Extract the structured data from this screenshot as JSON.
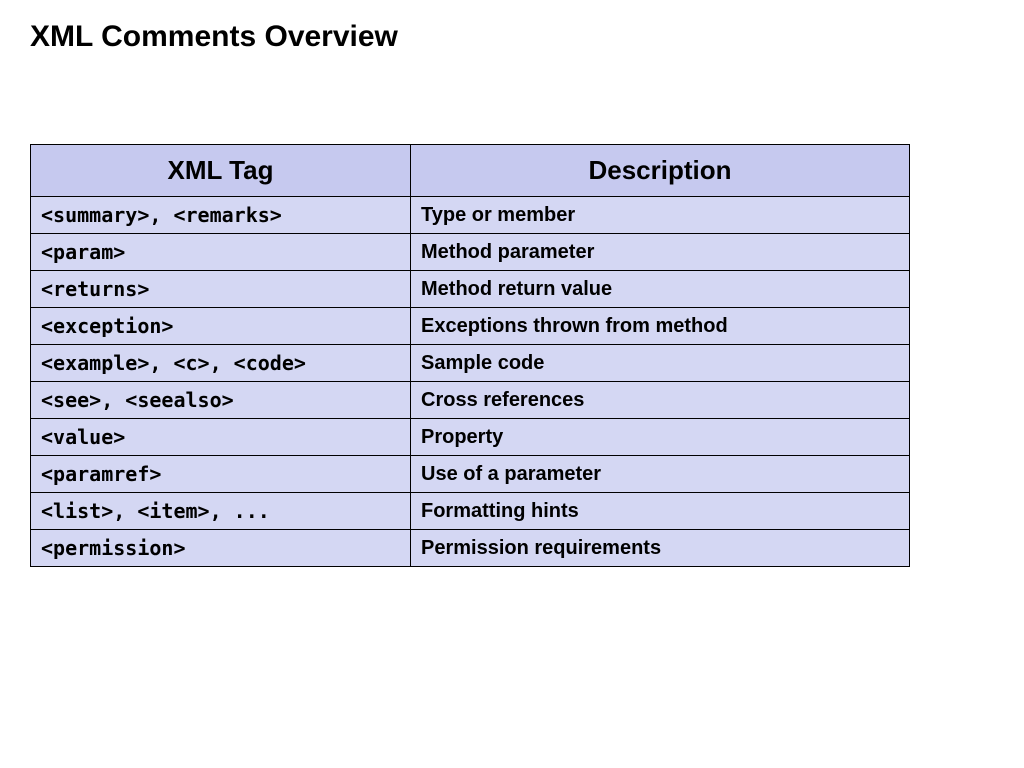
{
  "title": "XML Comments Overview",
  "table": {
    "headers": {
      "col1": "XML Tag",
      "col2": "Description"
    },
    "rows": [
      {
        "tag": "<summary>, <remarks>",
        "desc": "Type or member"
      },
      {
        "tag": "<param>",
        "desc": "Method parameter"
      },
      {
        "tag": "<returns>",
        "desc": "Method return value"
      },
      {
        "tag": "<exception>",
        "desc": "Exceptions thrown from method"
      },
      {
        "tag": "<example>, <c>, <code>",
        "desc": "Sample code"
      },
      {
        "tag": "<see>, <seealso>",
        "desc": "Cross references"
      },
      {
        "tag": "<value>",
        "desc": "Property"
      },
      {
        "tag": "<paramref>",
        "desc": "Use of a parameter"
      },
      {
        "tag": "<list>, <item>, ...",
        "desc": "Formatting hints"
      },
      {
        "tag": "<permission>",
        "desc": "Permission requirements"
      }
    ]
  },
  "chart_data": {
    "type": "table",
    "title": "XML Comments Overview",
    "columns": [
      "XML Tag",
      "Description"
    ],
    "rows": [
      [
        "<summary>, <remarks>",
        "Type or member"
      ],
      [
        "<param>",
        "Method parameter"
      ],
      [
        "<returns>",
        "Method return value"
      ],
      [
        "<exception>",
        "Exceptions thrown from method"
      ],
      [
        "<example>, <c>, <code>",
        "Sample code"
      ],
      [
        "<see>, <seealso>",
        "Cross references"
      ],
      [
        "<value>",
        "Property"
      ],
      [
        "<paramref>",
        "Use of a parameter"
      ],
      [
        "<list>, <item>, ...",
        "Formatting hints"
      ],
      [
        "<permission>",
        "Permission requirements"
      ]
    ]
  }
}
